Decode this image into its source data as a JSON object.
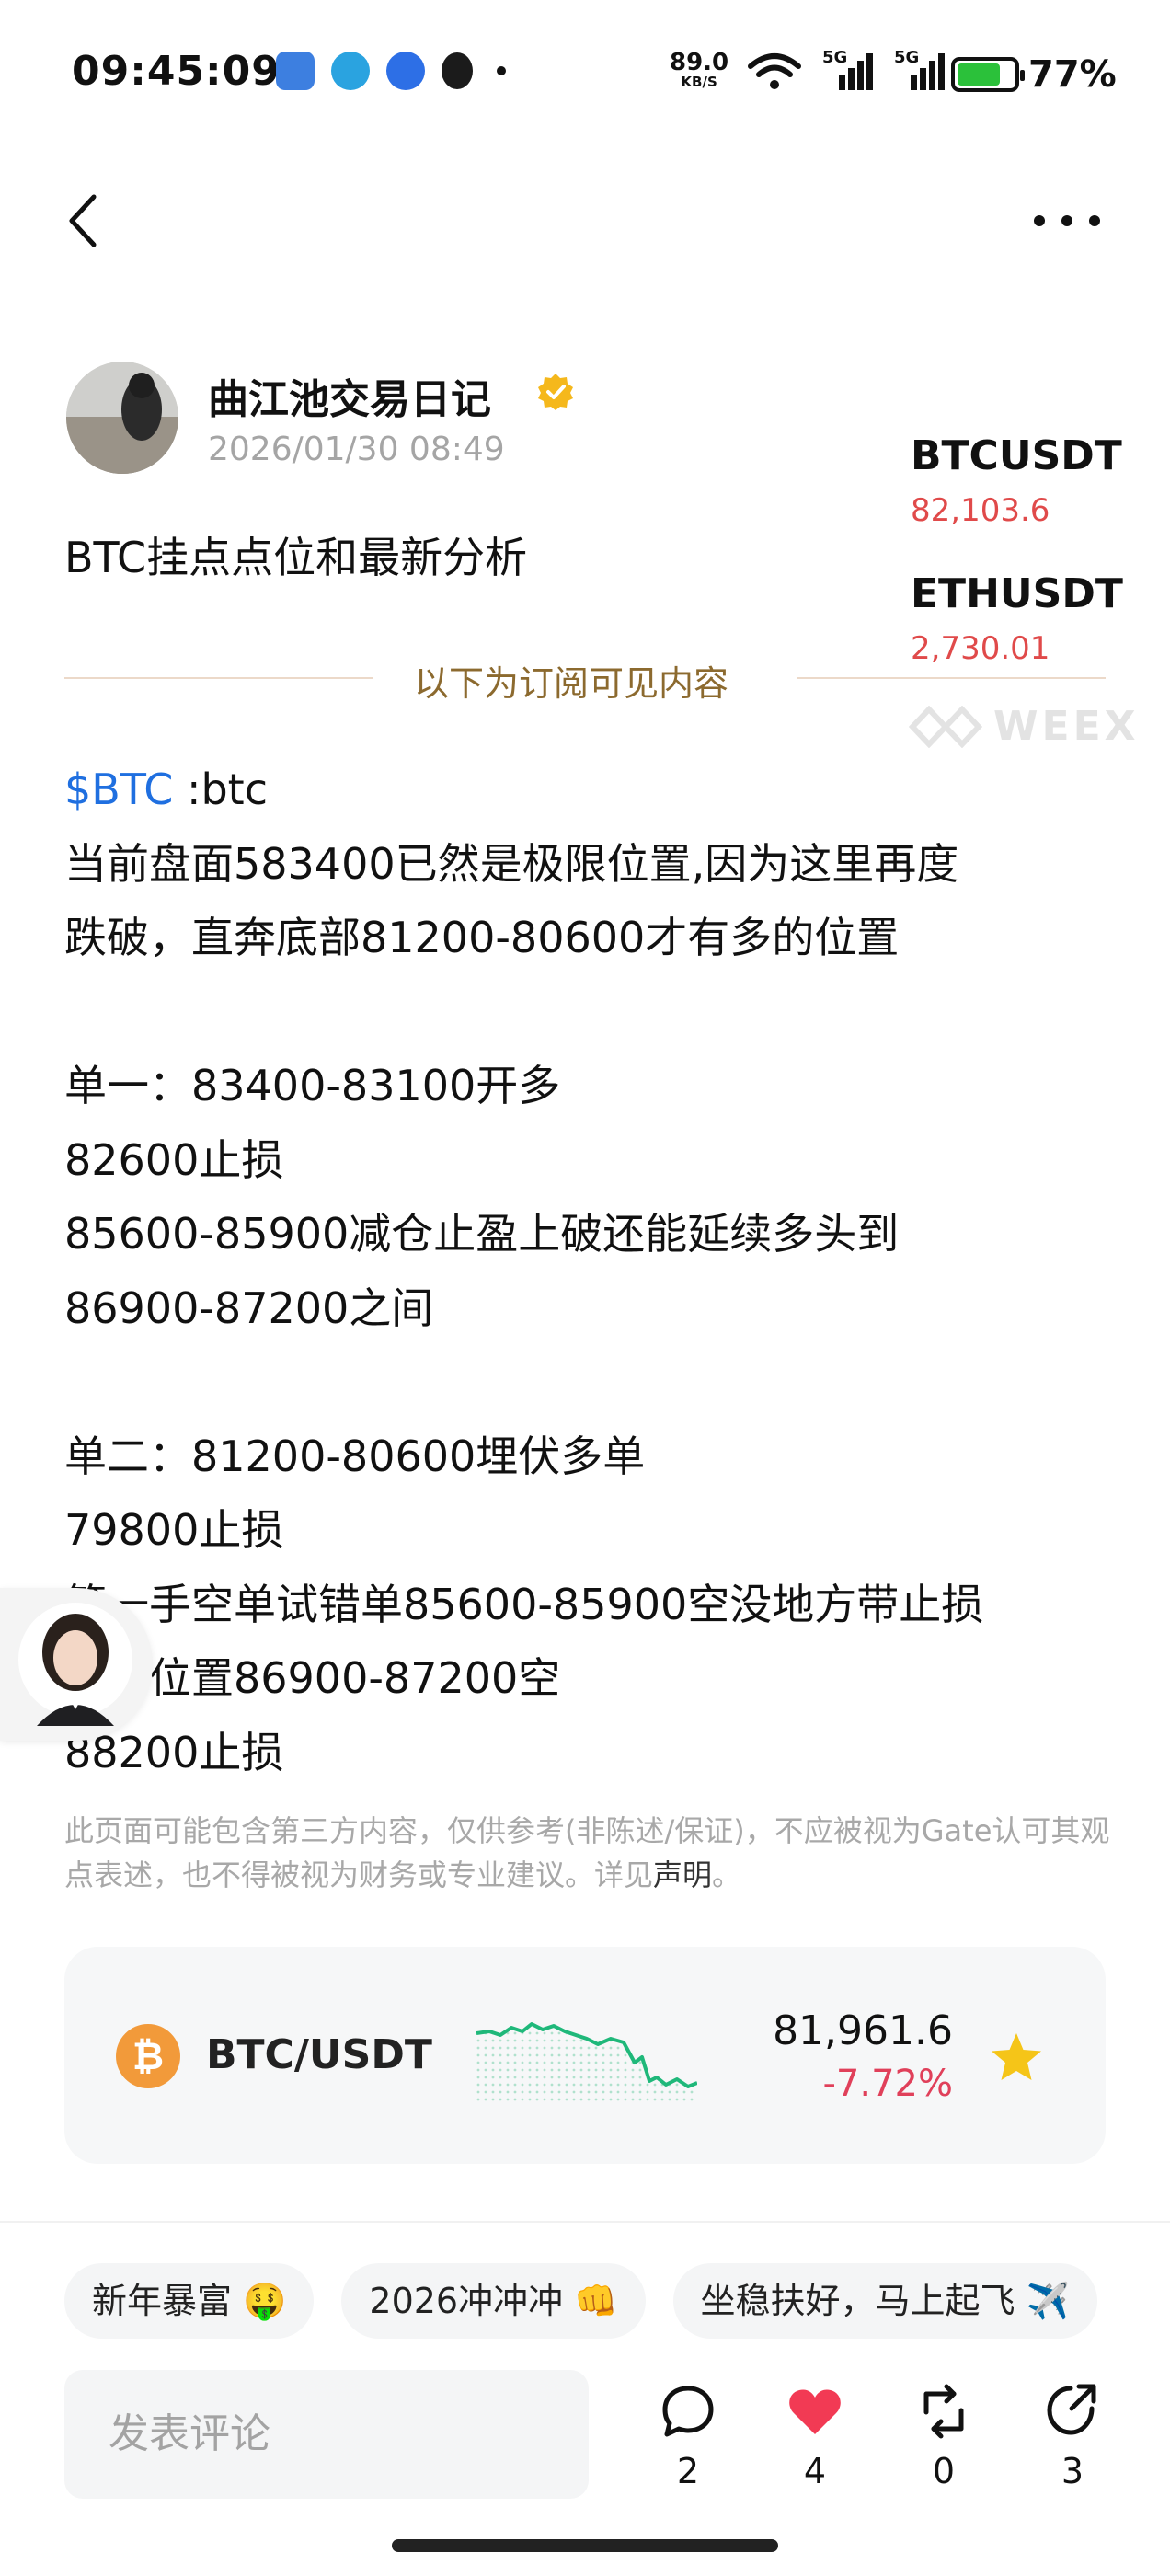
{
  "status_bar": {
    "time": "09:45:09",
    "net_speed_value": "89.0",
    "net_speed_unit": "KB/S",
    "signal_1_label": "5G",
    "signal_2_label": "5G",
    "battery_percent": "77%",
    "battery_level": 0.77,
    "icons": [
      "map-app-icon",
      "telegram-icon",
      "cloud-app-icon",
      "qq-icon",
      "notification-dot"
    ]
  },
  "nav": {
    "back_icon": "chevron-left-icon",
    "more_icon": "more-dots-icon"
  },
  "author": {
    "name": "曲江池交易日记",
    "date": "2026/01/30 08:49",
    "verified_icon": "verified-badge-icon"
  },
  "ticker": [
    {
      "symbol": "BTCUSDT",
      "price": "82,103.6"
    },
    {
      "symbol": "ETHUSDT",
      "price": "2,730.01"
    }
  ],
  "watermark": "WEEX",
  "post": {
    "title": "BTC挂点点位和最新分析",
    "subscription_divider": "以下为订阅可见内容",
    "tag": "$BTC",
    "tag_suffix": " :btc",
    "body": "当前盘面583400已然是极限位置,因为这里再度\n跌破，直奔底部81200-80600才有多的位置\n\n单一：83400-83100开多\n82600止损\n85600-85900减仓止盈上破还能延续多头到\n86900-87200之间\n\n单二：81200-80600埋伏多单\n79800止损\n第一手空单试错单85600-85900空没地方带止损\n二单位置86900-87200空\n88200止损"
  },
  "disclaimer": {
    "text": "此页面可能包含第三方内容，仅供参考(非陈述/保证)，不应被视为Gate认可其观点表述，也不得被视为财务或专业建议。详见",
    "link": "声明",
    "end": "。"
  },
  "market_card": {
    "coin_symbol": "₿",
    "pair": "BTC/USDT",
    "price": "81,961.6",
    "change": "-7.72%",
    "favorite_icon": "star-icon",
    "colors": {
      "sparkline": "#1fb87a",
      "change": "#e0405a",
      "star": "#f5c518"
    }
  },
  "chips": [
    {
      "label": "新年暴富 🤑"
    },
    {
      "label": "2026冲冲冲 👊"
    },
    {
      "label": "坐稳扶好，马上起飞 ✈️"
    }
  ],
  "comment_bar": {
    "placeholder": "发表评论",
    "actions": [
      {
        "icon": "comment-icon",
        "count": "2"
      },
      {
        "icon": "heart-icon",
        "count": "4"
      },
      {
        "icon": "repost-icon",
        "count": "0"
      },
      {
        "icon": "share-icon",
        "count": "3"
      }
    ]
  }
}
